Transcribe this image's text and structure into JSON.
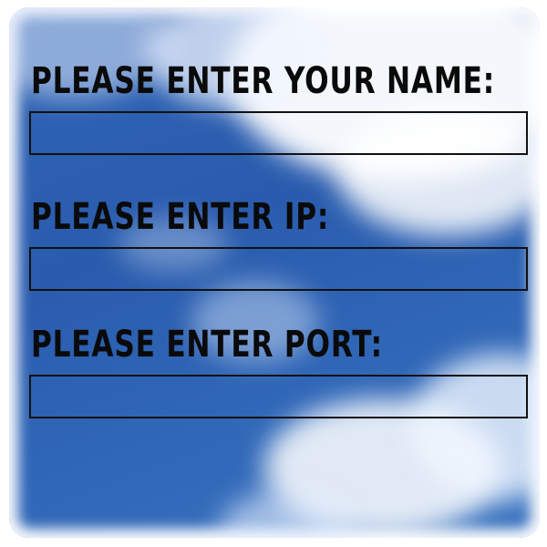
{
  "form": {
    "name_label": "Please Enter Your Name:",
    "name_value": "",
    "ip_label": "Please Enter IP:",
    "ip_value": "",
    "port_label": "Please Enter Port:",
    "port_value": ""
  },
  "colors": {
    "sky_blue": "#2f64b4",
    "label_text": "#0a0a0a",
    "field_border": "#111111"
  }
}
